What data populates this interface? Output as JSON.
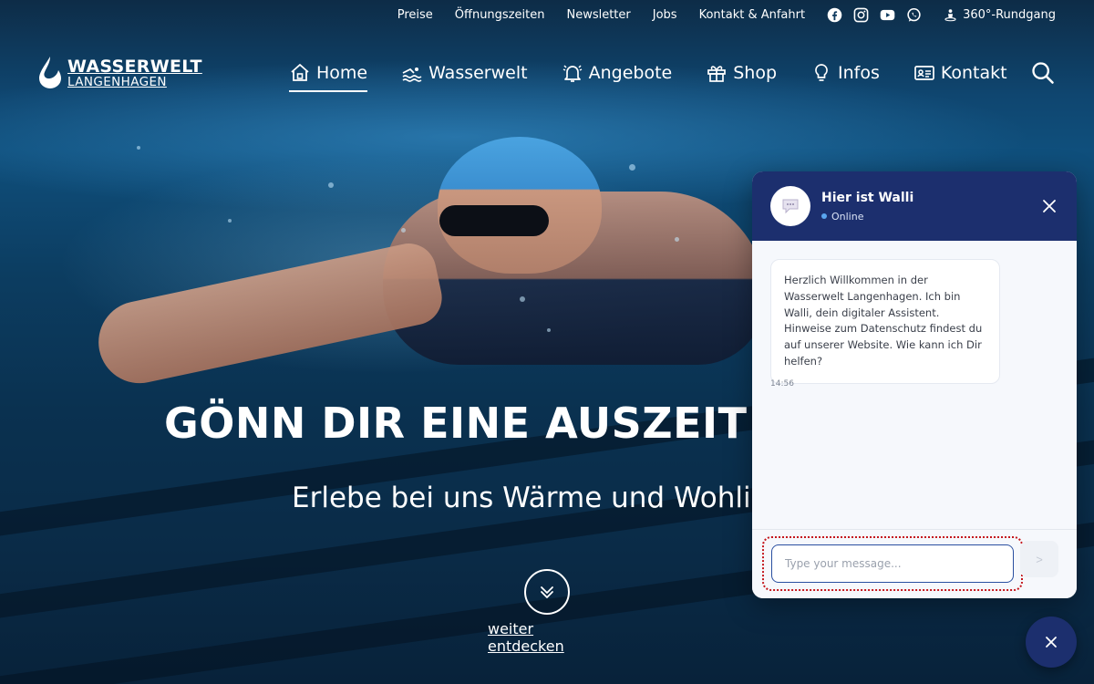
{
  "topbar": {
    "links": [
      "Preise",
      "Öffnungszeiten",
      "Newsletter",
      "Jobs",
      "Kontakt & Anfahrt"
    ],
    "social_icons": [
      "facebook-icon",
      "instagram-icon",
      "youtube-icon",
      "whatsapp-icon"
    ],
    "tour_label": "360°-Rundgang"
  },
  "logo": {
    "title": "WASSERWELT",
    "subtitle": "LANGENHAGEN"
  },
  "nav": {
    "items": [
      {
        "label": "Home",
        "icon": "house-icon",
        "active": true
      },
      {
        "label": "Wasserwelt",
        "icon": "swimmer-icon",
        "active": false
      },
      {
        "label": "Angebote",
        "icon": "bell-icon",
        "active": false
      },
      {
        "label": "Shop",
        "icon": "gift-icon",
        "active": false
      },
      {
        "label": "Infos",
        "icon": "lightbulb-icon",
        "active": false
      },
      {
        "label": "Kontakt",
        "icon": "contact-card-icon",
        "active": false
      }
    ],
    "search_icon": "search-icon"
  },
  "hero": {
    "title": "GÖNN DIR EINE AUSZEIT VOM",
    "subtitle": "Erlebe bei uns Wärme und Wohlig",
    "explore_label": "weiter entdecken"
  },
  "chat": {
    "name": "Hier ist Walli",
    "status": "Online",
    "message": "Herzlich Willkommen in der Wasserwelt Langenhagen. Ich bin Walli, dein digitaler Assistent. Hinweise zum Datenschutz findest du auf unserer Website. Wie kann ich Dir helfen?",
    "time": "14:56",
    "input_placeholder": "Type your message...",
    "send_label": ">"
  },
  "colors": {
    "chat_header": "#1c2f6e",
    "input_border": "#2a4fa0",
    "highlight_dots": "#c4161c",
    "status_dot": "#5aa6ef"
  }
}
